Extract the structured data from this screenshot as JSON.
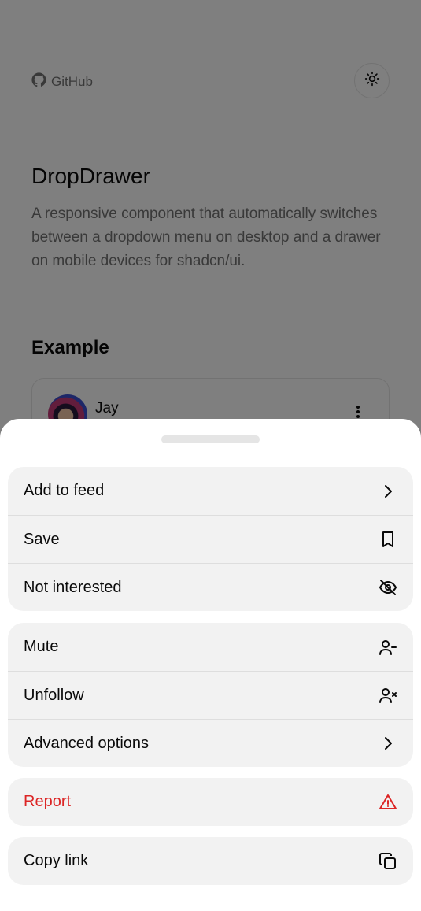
{
  "header": {
    "github_label": "GitHub",
    "theme_icon": "sun-icon"
  },
  "main": {
    "title": "DropDrawer",
    "description": "A responsive component that automatically switches between a dropdown menu on desktop and a drawer on mobile devices for shadcn/ui.",
    "example_title": "Example",
    "card": {
      "name": "Jay",
      "more_icon": "more-vertical-icon"
    }
  },
  "drawer": {
    "groups": [
      {
        "items": [
          {
            "label": "Add to feed",
            "icon": "chevron-right-icon"
          },
          {
            "label": "Save",
            "icon": "bookmark-icon"
          },
          {
            "label": "Not interested",
            "icon": "eye-off-icon"
          }
        ]
      },
      {
        "items": [
          {
            "label": "Mute",
            "icon": "user-minus-icon"
          },
          {
            "label": "Unfollow",
            "icon": "user-x-icon"
          },
          {
            "label": "Advanced options",
            "icon": "chevron-right-icon"
          }
        ]
      },
      {
        "items": [
          {
            "label": "Report",
            "icon": "alert-triangle-icon"
          }
        ]
      },
      {
        "items": [
          {
            "label": "Copy link",
            "icon": "copy-icon"
          }
        ]
      }
    ]
  },
  "colors": {
    "danger": "#dc2626",
    "muted_text": "#737373",
    "item_background": "#f2f2f2"
  }
}
